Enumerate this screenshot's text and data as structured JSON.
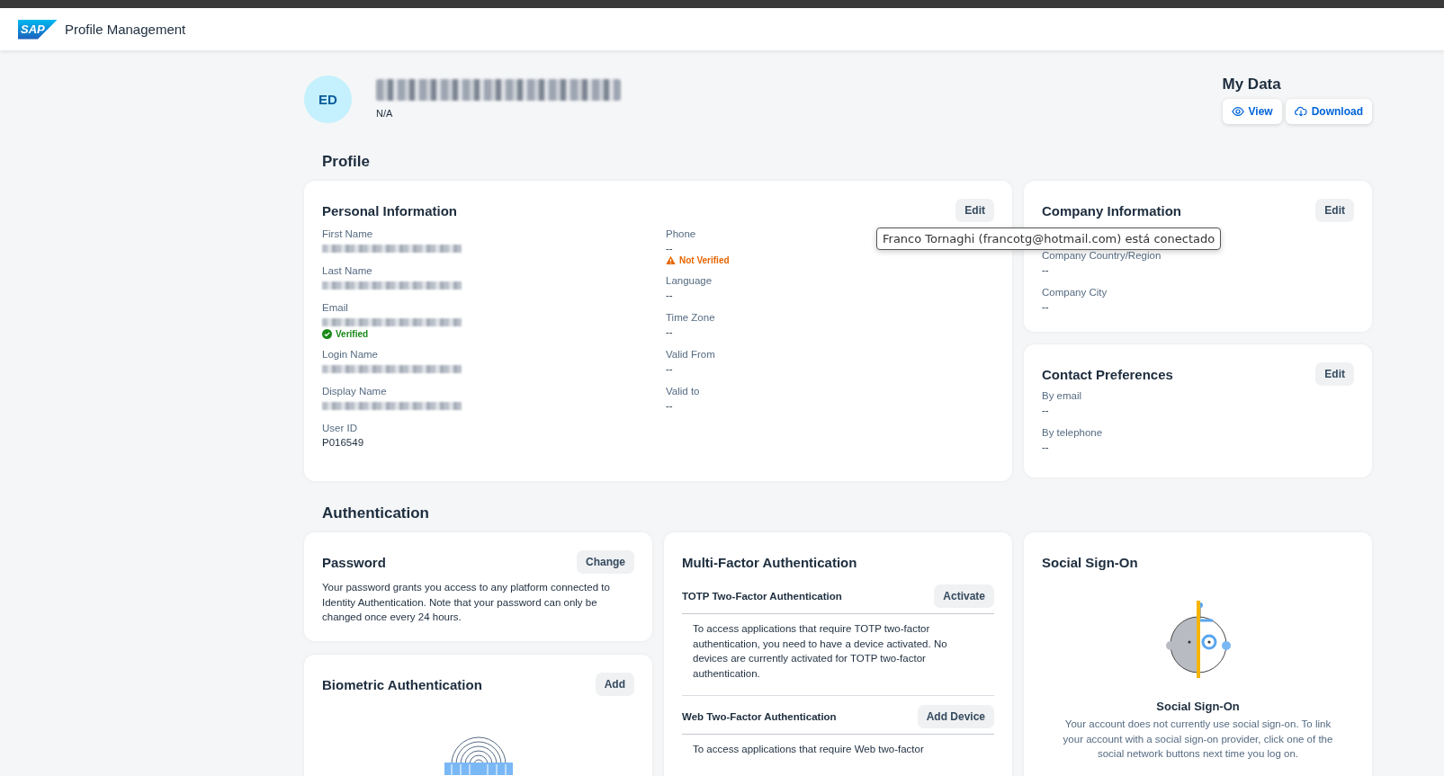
{
  "app": {
    "logo": "SAP",
    "title": "Profile Management"
  },
  "user": {
    "initials": "ED",
    "subtitle": "N/A"
  },
  "my_data": {
    "title": "My Data",
    "buttons": [
      {
        "label": "View",
        "kind": "view"
      },
      {
        "label": "Download",
        "kind": "download"
      }
    ]
  },
  "profile": {
    "heading": "Profile",
    "personal": {
      "title": "Personal Information",
      "action": "Edit",
      "columns": [
        [
          {
            "label": "First Name",
            "kind": "redacted"
          },
          {
            "label": "Last Name",
            "kind": "redacted"
          },
          {
            "label": "Email",
            "kind": "redacted",
            "status": {
              "label": "Verified",
              "kind": "ok"
            }
          },
          {
            "label": "Login Name",
            "kind": "redacted"
          },
          {
            "label": "Display Name",
            "kind": "redacted"
          },
          {
            "label": "User ID",
            "kind": "text",
            "value": "P016549"
          }
        ],
        [
          {
            "label": "Phone",
            "kind": "text",
            "value": "--",
            "status": {
              "label": "Not Verified",
              "kind": "warning"
            }
          },
          {
            "label": "Language",
            "kind": "text",
            "value": "--"
          },
          {
            "label": "Time Zone",
            "kind": "text",
            "value": "--"
          },
          {
            "label": "Valid From",
            "kind": "text",
            "value": "--"
          },
          {
            "label": "Valid to",
            "kind": "text",
            "value": "--"
          }
        ]
      ]
    },
    "company": {
      "title": "Company Information",
      "action": "Edit",
      "fields": [
        {
          "label": "Company Country/Region",
          "kind": "text",
          "value": "--"
        },
        {
          "label": "Company City",
          "kind": "text",
          "value": "--"
        }
      ]
    },
    "contact": {
      "title": "Contact Preferences",
      "action": "Edit",
      "fields": [
        {
          "label": "By email",
          "kind": "text",
          "value": "--"
        },
        {
          "label": "By telephone",
          "kind": "text",
          "value": "--"
        }
      ]
    }
  },
  "tooltip": {
    "text": "Franco Tornaghi (francotg@hotmail.com) está conectado"
  },
  "authentication": {
    "heading": "Authentication",
    "password": {
      "title": "Password",
      "action": "Change",
      "text": "Your password grants you access to any platform connected to Identity Authentication. Note that your password can only be changed once every 24 hours."
    },
    "biometric": {
      "title": "Biometric Authentication",
      "action": "Add"
    },
    "mfa": {
      "title": "Multi-Factor Authentication",
      "sections": [
        {
          "title": "TOTP Two-Factor Authentication",
          "action": "Activate",
          "text": "To access applications that require TOTP two-factor authentication, you need to have a device activated. No devices are currently activated for TOTP two-factor authentication."
        },
        {
          "title": "Web Two-Factor Authentication",
          "action": "Add Device",
          "text": "To access applications that require Web two-factor"
        }
      ]
    },
    "social": {
      "title": "Social Sign-On",
      "subtitle": "Social Sign-On",
      "text": "Your account does not currently use social sign-on. To link your account with a social sign-on provider, click one of the social network buttons next time you log on."
    }
  }
}
